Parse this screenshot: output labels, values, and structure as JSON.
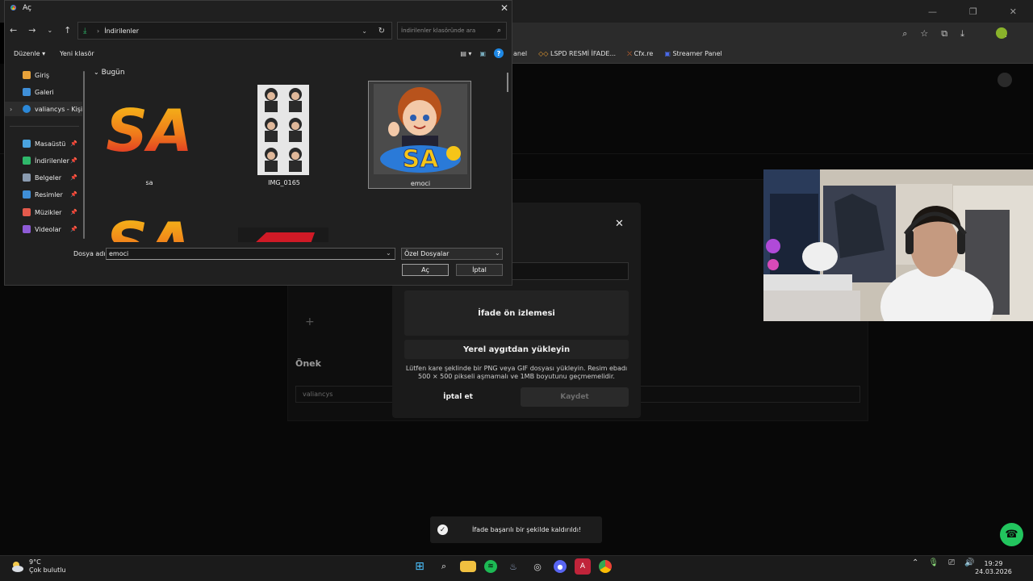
{
  "dialog": {
    "title": "Aç",
    "close_glyph": "✕",
    "path": "İndirilenler",
    "search_placeholder": "İndirilenler klasöründe ara",
    "toolbar": {
      "organize": "Düzenle ▾",
      "new_folder": "Yeni klasör"
    },
    "nav_items": [
      {
        "label": "Giriş",
        "icon": "home-icon",
        "color": "#e8a23a",
        "pinned": false
      },
      {
        "label": "Galeri",
        "icon": "gallery-icon",
        "color": "#3f8fd8",
        "pinned": false
      },
      {
        "label": "valiancys - Kişisel",
        "icon": "onedrive-icon",
        "color": "#2b88d8",
        "pinned": false
      },
      {
        "label": "Masaüstü",
        "icon": "desktop-icon",
        "color": "#4aa3df",
        "pinned": true
      },
      {
        "label": "İndirilenler",
        "icon": "downloads-icon",
        "color": "#2fb86b",
        "pinned": true
      },
      {
        "label": "Belgeler",
        "icon": "documents-icon",
        "color": "#8a9bb0",
        "pinned": true
      },
      {
        "label": "Resimler",
        "icon": "pictures-icon",
        "color": "#3f8fd8",
        "pinned": true
      },
      {
        "label": "Müzikler",
        "icon": "music-icon",
        "color": "#e45a4c",
        "pinned": true
      },
      {
        "label": "Videolar",
        "icon": "videos-icon",
        "color": "#8e5bd6",
        "pinned": true
      }
    ],
    "group_header": "Bugün",
    "files": [
      {
        "name": "sa"
      },
      {
        "name": "IMG_0165"
      },
      {
        "name": "emoci",
        "selected": true
      }
    ],
    "filename_label": "Dosya adı:",
    "filename_value": "emoci",
    "filetype_value": "Özel Dosyalar",
    "open_label": "Aç",
    "cancel_label": "İptal"
  },
  "browser": {
    "bookmarks": [
      "anel",
      "LSPD  RESMİ İFADE...",
      "Cfx.re",
      "Streamer Panel"
    ]
  },
  "modal": {
    "close_glyph": "✕",
    "preview_label": "İfade ön izlemesi",
    "upload_label": "Yerel aygıtdan yükleyin",
    "hint": "Lütfen kare şeklinde bir PNG veya GIF dosyası yükleyin. Resim ebadı 500 × 500 pikseli aşmamalı ve 1MB boyutunu geçmemelidir.",
    "cancel_label": "İptal et",
    "save_label": "Kaydet"
  },
  "page": {
    "prefix_label": "Önek",
    "prefix_value": "valiancys",
    "plus_glyph": "+"
  },
  "toast": {
    "text": "İfade başarılı bir şekilde kaldırıldı!"
  },
  "taskbar": {
    "temperature": "9°C",
    "weather": "Çok bulutlu",
    "time": "19:29",
    "date": "24.03.2026"
  },
  "colors": {
    "accent_green": "#22c55e",
    "download_green": "#2fb86b"
  }
}
